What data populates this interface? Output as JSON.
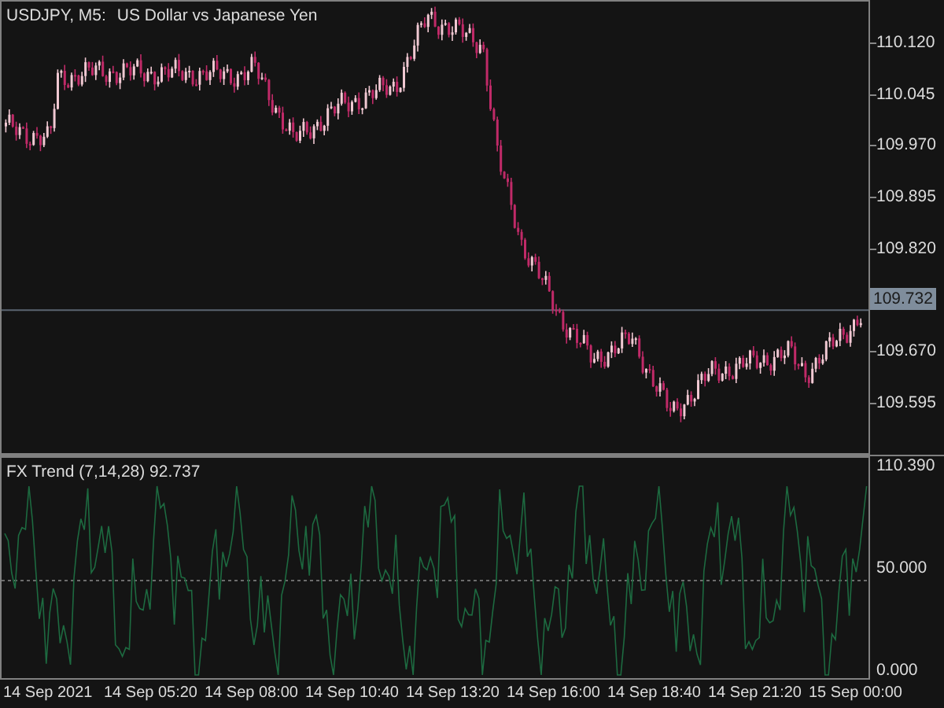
{
  "chart": {
    "symbol": "USDJPY, M5:",
    "description": "US Dollar vs Japanese Yen"
  },
  "price_axis": [
    {
      "kind": "tick",
      "text": "110.120"
    },
    {
      "kind": "tick",
      "text": "110.045"
    },
    {
      "kind": "tick",
      "text": "109.970"
    },
    {
      "kind": "tick",
      "text": "109.895"
    },
    {
      "kind": "tick",
      "text": "109.820"
    },
    {
      "kind": "current",
      "text": "109.732"
    },
    {
      "kind": "tick",
      "text": "109.670"
    },
    {
      "kind": "tick",
      "text": "109.595"
    }
  ],
  "indicator": {
    "title": "FX Trend (7,14,28) 92.737",
    "axis": [
      "110.390",
      "50.000",
      "0.000"
    ]
  },
  "time_axis": [
    "14 Sep 2021",
    "14 Sep 05:20",
    "14 Sep 08:00",
    "14 Sep 10:40",
    "14 Sep 13:20",
    "14 Sep 16:00",
    "14 Sep 18:40",
    "14 Sep 21:20",
    "15 Sep 00:00"
  ]
}
